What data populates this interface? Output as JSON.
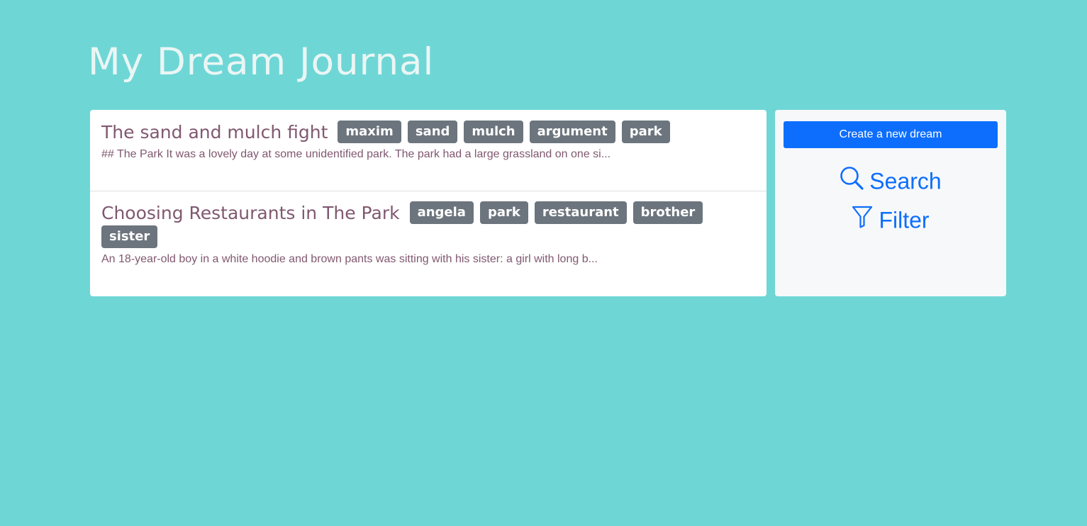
{
  "page": {
    "title": "My Dream Journal"
  },
  "dreams": [
    {
      "title": "The sand and mulch fight",
      "tags": [
        "maxim",
        "sand",
        "mulch",
        "argument",
        "park"
      ],
      "excerpt": "## The Park It was a lovely day at some unidentified park. The park had a large grassland on one si..."
    },
    {
      "title": "Choosing Restaurants in The Park",
      "tags": [
        "angela",
        "park",
        "restaurant",
        "brother",
        "sister"
      ],
      "excerpt": "An 18-year-old boy in a white hoodie and brown pants was sitting with his sister: a girl with long b..."
    }
  ],
  "sidebar": {
    "create_label": "Create a new dream",
    "search_label": "Search",
    "search_icon": "search-icon",
    "filter_label": "Filter",
    "filter_icon": "funnel-icon"
  },
  "colors": {
    "background": "#6fd6d6",
    "title_text": "#eaf6f4",
    "dream_text": "#805870",
    "tag_background": "#6c757d",
    "accent": "#0d6efd"
  }
}
